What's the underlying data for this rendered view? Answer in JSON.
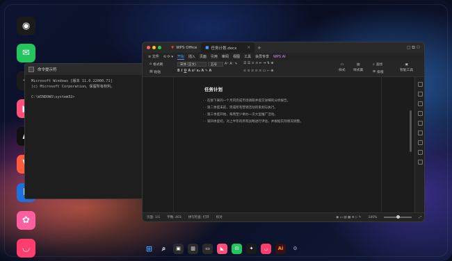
{
  "desktop_icons": [
    {
      "name": "github-icon",
      "glyph": "◉",
      "bg": "#1b1b1b"
    },
    {
      "name": "wechat-icon",
      "glyph": "✉",
      "bg": "#22c55e"
    },
    {
      "name": "figma-icon",
      "glyph": "✦",
      "bg": "#1b1b1b"
    },
    {
      "name": "bookmark-app-icon",
      "glyph": "◣",
      "bg": "#ff4f7a"
    },
    {
      "name": "app-a-icon",
      "glyph": "A",
      "bg": "#111"
    },
    {
      "name": "app-v-icon",
      "glyph": "V",
      "bg": "#ff5a3c"
    },
    {
      "name": "app-e-icon",
      "glyph": "E",
      "bg": "#1e6fe0"
    },
    {
      "name": "app-pink-icon",
      "glyph": "✿",
      "bg": "#ff5fa0"
    },
    {
      "name": "app-cup-icon",
      "glyph": "◡",
      "bg": "#ff3d6e"
    },
    {
      "name": "app-red-icon",
      "glyph": "◔",
      "bg": "#ff3355"
    }
  ],
  "cmd": {
    "title": "命令提示符",
    "lines": [
      "Microsoft Windows [版本 11.0.22000.71]",
      "(c) Microsoft Corporation。保留所有权利。",
      "",
      "C:\\WINDOWS\\system32>"
    ]
  },
  "wps": {
    "tabs": [
      {
        "label": "WPS Office"
      },
      {
        "label": "任务计划.docx"
      }
    ],
    "menu": [
      "≡ 文件",
      "开始",
      "插入",
      "页面",
      "引用",
      "审阅",
      "视图",
      "工具",
      "会员专享",
      "WPS AI"
    ],
    "font_name": "宋体 (正文)",
    "font_size": "五号",
    "ribbon_labels": [
      "格式刷",
      "粘贴",
      "样式",
      "样式集",
      "查找",
      "排版",
      "智能工具"
    ],
    "doc_title": "任务计划",
    "doc_items": [
      "· 在接下来的一个月内完成市场调研并提交详细的分析报告。",
      "· 第二季度末前，完成所有营销活动的策划与执行。",
      "· 第三季度开始，每周至少举办一次大型推广活动。",
      "· 第四季度初，对上半年的所有战略进行评估，并根据实际情况调整。"
    ],
    "status": [
      "页面: 1/1",
      "字数: 403",
      "拼写检查: 打开",
      "校对"
    ],
    "zoom": "100%"
  },
  "accent": "#4a9cff"
}
